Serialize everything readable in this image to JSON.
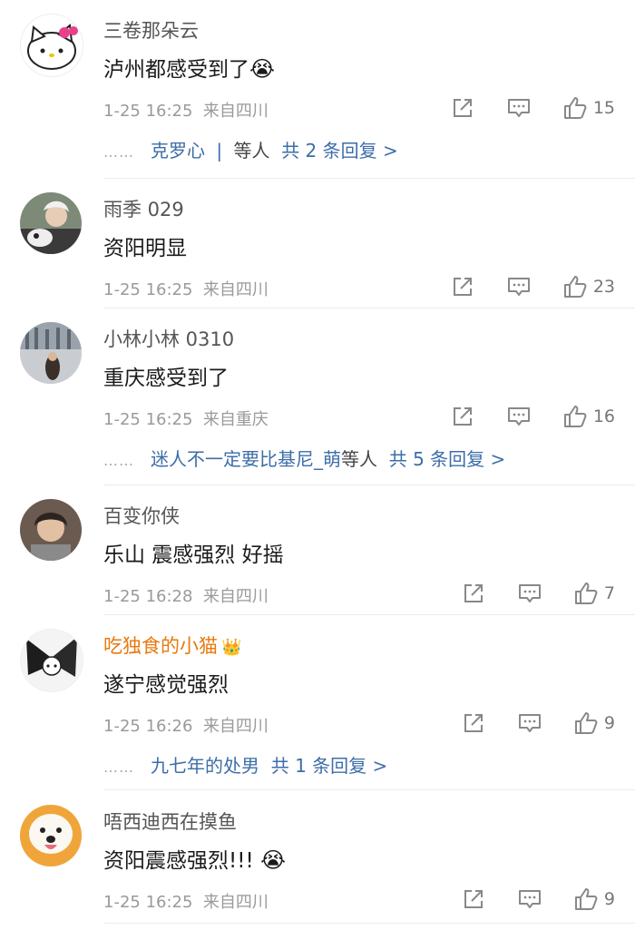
{
  "comments": [
    {
      "username": "三卷那朵云",
      "text": "泸州都感受到了",
      "emoji": "😭",
      "time": "1-25 16:25",
      "location": "来自四川",
      "likes": "15",
      "replies": {
        "names": "克罗心",
        "separator": "|",
        "suffix": "等人",
        "count": "共 2 条回复 >"
      }
    },
    {
      "username": "雨季 029",
      "text": "资阳明显",
      "time": "1-25 16:25",
      "location": "来自四川",
      "likes": "23"
    },
    {
      "username": "小林小林 0310",
      "text": "重庆感受到了",
      "time": "1-25 16:25",
      "location": "来自重庆",
      "likes": "16",
      "replies": {
        "names": "迷人不一定要比基尼_萌",
        "suffix": "等人",
        "count": "共 5 条回复 >"
      }
    },
    {
      "username": "百变你侠",
      "text": "乐山 震感强烈 好摇",
      "time": "1-25 16:28",
      "location": "来自四川",
      "likes": "7"
    },
    {
      "username": "吃独食的小猫",
      "badge_icon": "crown-icon",
      "text": "遂宁感觉强烈",
      "time": "1-25 16:26",
      "location": "来自四川",
      "likes": "9",
      "replies": {
        "names": "九七年的处男",
        "count": "共 1 条回复 >"
      }
    },
    {
      "username": "唔西迪西在摸鱼",
      "text": "资阳震感强烈!!!",
      "emoji": "😭",
      "time": "1-25 16:25",
      "location": "来自四川",
      "likes": "9"
    }
  ],
  "dots": "……",
  "colors": {
    "link": "#3d6da8",
    "vip": "#e8790f",
    "meta": "#9a9a9a"
  }
}
